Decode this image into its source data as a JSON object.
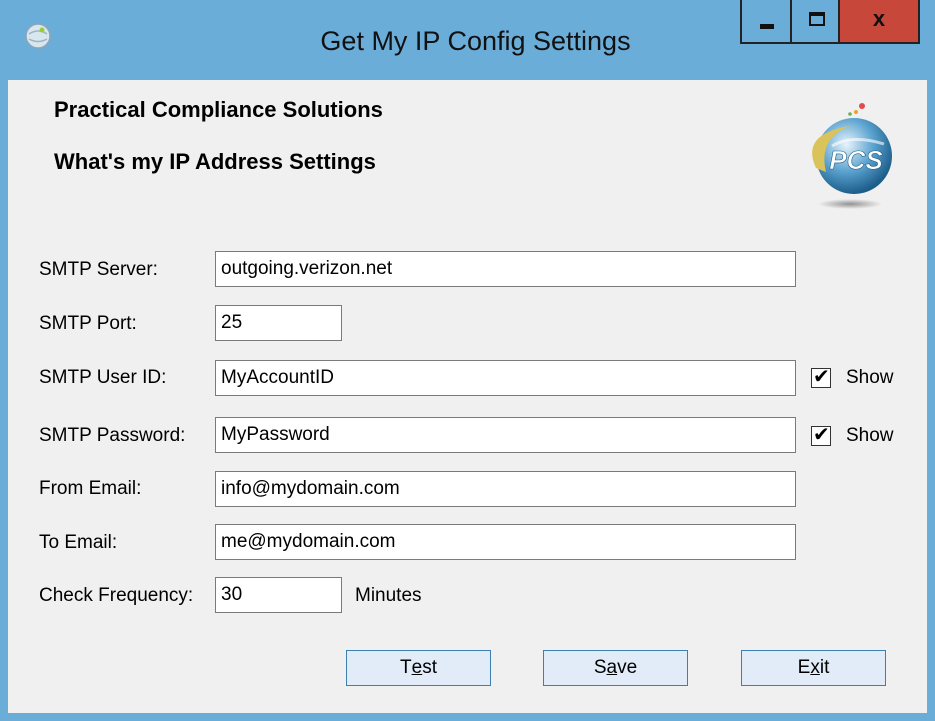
{
  "window": {
    "title": "Get My IP Config Settings",
    "accent_color": "#6badd9",
    "close_color": "#c7473a",
    "app_icon": "globe-icon"
  },
  "captions": {
    "minimize_icon": "minimize-icon",
    "maximize_icon": "maximize-icon",
    "close_glyph": "x"
  },
  "header": {
    "company": "Practical Compliance Solutions",
    "subtitle": "What's my IP Address Settings",
    "logo_text": "PCS"
  },
  "form": {
    "smtp_server": {
      "label": "SMTP Server:",
      "value": "outgoing.verizon.net"
    },
    "smtp_port": {
      "label": "SMTP Port:",
      "value": "25"
    },
    "smtp_user": {
      "label": "SMTP User ID:",
      "value": "MyAccountID",
      "show_label": "Show",
      "show_checked": true
    },
    "smtp_password": {
      "label": "SMTP Password:",
      "value": "MyPassword",
      "show_label": "Show",
      "show_checked": true
    },
    "from_email": {
      "label": "From Email:",
      "value": "info@mydomain.com"
    },
    "to_email": {
      "label": "To Email:",
      "value": "me@mydomain.com"
    },
    "check_frequency": {
      "label": "Check Frequency:",
      "value": "30",
      "unit": "Minutes"
    }
  },
  "buttons": {
    "test": {
      "pre": "T",
      "accel": "e",
      "post": "st"
    },
    "save": {
      "pre": "S",
      "accel": "a",
      "post": "ve"
    },
    "exit": {
      "pre": "E",
      "accel": "x",
      "post": "it"
    }
  }
}
